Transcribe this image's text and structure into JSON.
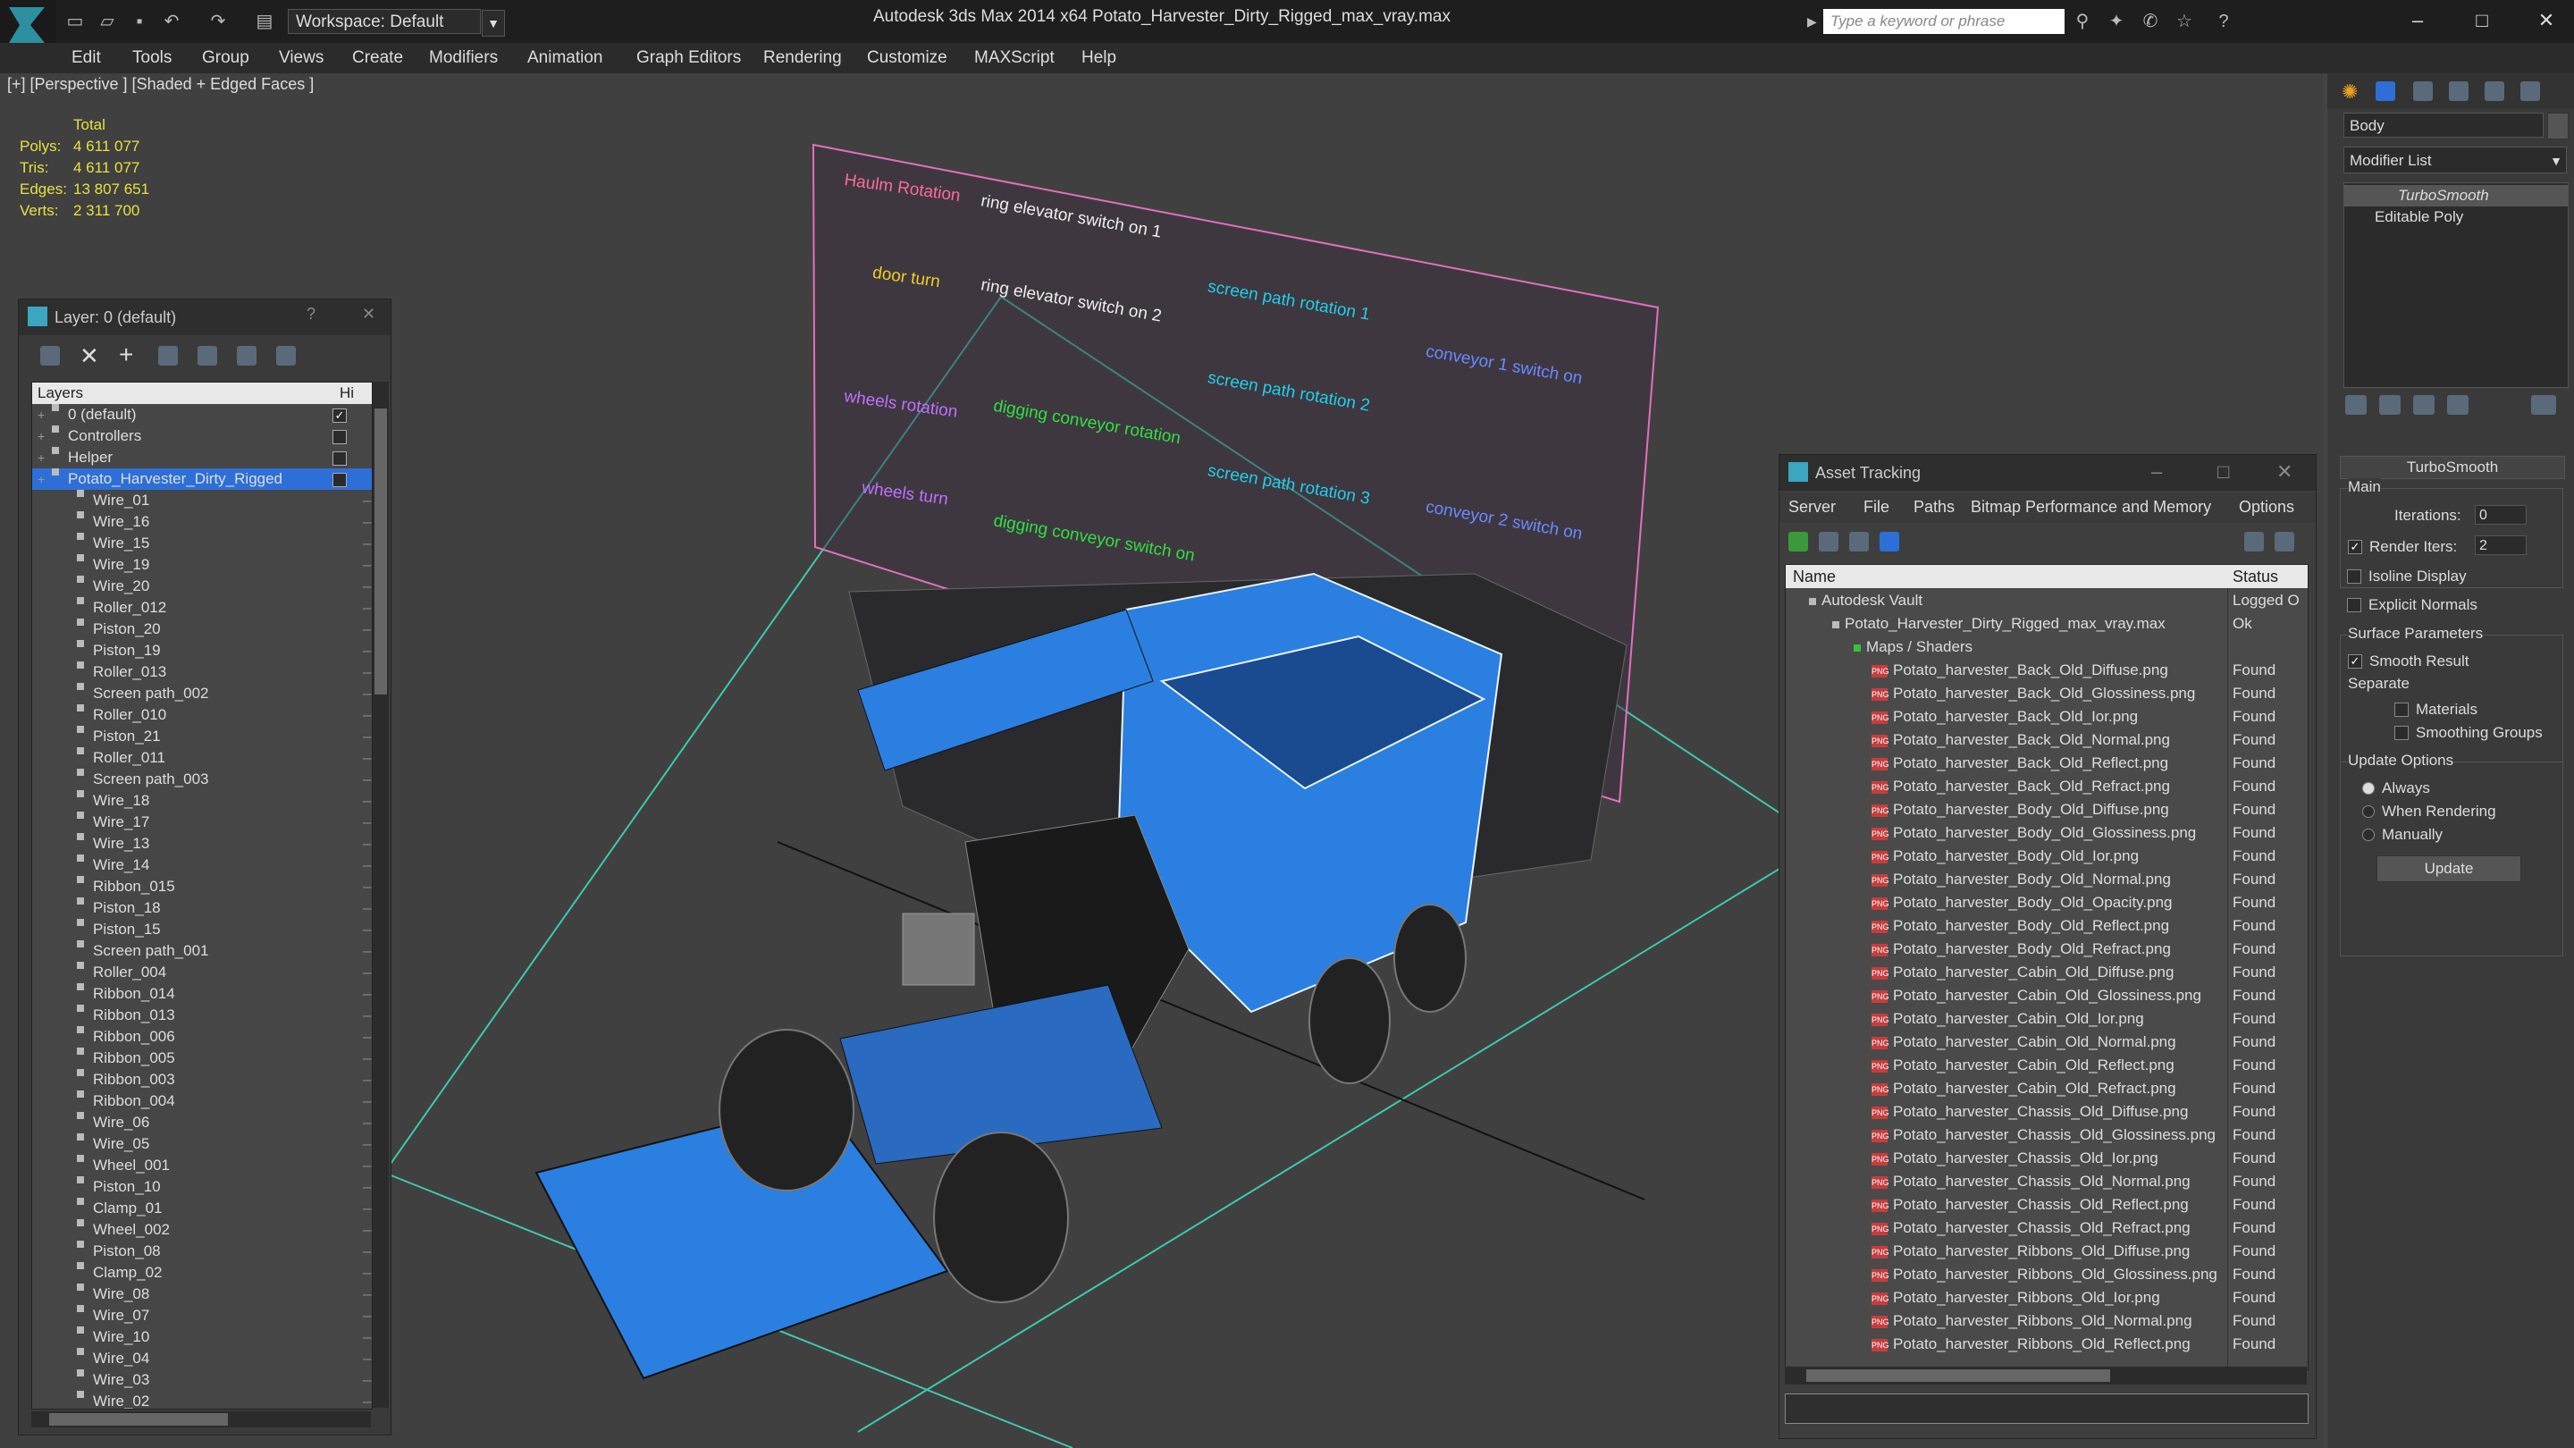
{
  "app": {
    "title": "Autodesk 3ds Max  2014 x64     Potato_Harvester_Dirty_Rigged_max_vray.max",
    "workspace": "Workspace: Default",
    "search_placeholder": "Type a keyword or phrase"
  },
  "menu": [
    "Edit",
    "Tools",
    "Group",
    "Views",
    "Create",
    "Modifiers",
    "Animation",
    "Graph Editors",
    "Rendering",
    "Customize",
    "MAXScript",
    "Help"
  ],
  "viewport": {
    "label": "[+] [Perspective ] [Shaded + Edged Faces ]",
    "stats": {
      "header": "Total",
      "rows": [
        {
          "label": "Polys:",
          "value": "4 611 077"
        },
        {
          "label": "Tris:",
          "value": "4 611 077"
        },
        {
          "label": "Edges:",
          "value": "13 807 651"
        },
        {
          "label": "Verts:",
          "value": "2 311 700"
        }
      ]
    },
    "board_labels": [
      "Haulm Rotation",
      "ring elevator switch on 1",
      "door turn",
      "ring elevator switch on 2",
      "screen path rotation 1",
      "conveyor 1 switch on",
      "wheels rotation",
      "digging conveyor rotation",
      "screen path rotation 2",
      "wheels turn",
      "screen path rotation 3",
      "conveyor 2 switch on",
      "digging conveyor switch on"
    ]
  },
  "layer_panel": {
    "title": "Layer: 0 (default)",
    "help": "?",
    "col_layers": "Layers",
    "col_hide": "Hi",
    "top_layers": [
      {
        "name": "0 (default)",
        "state": "✓"
      },
      {
        "name": "Controllers",
        "state": ""
      },
      {
        "name": "Helper",
        "state": ""
      },
      {
        "name": "Potato_Harvester_Dirty_Rigged",
        "state": ""
      }
    ],
    "objects": [
      "Wire_01",
      "Wire_16",
      "Wire_15",
      "Wire_19",
      "Wire_20",
      "Roller_012",
      "Piston_20",
      "Piston_19",
      "Roller_013",
      "Screen path_002",
      "Roller_010",
      "Piston_21",
      "Roller_011",
      "Screen path_003",
      "Wire_18",
      "Wire_17",
      "Wire_13",
      "Wire_14",
      "Ribbon_015",
      "Piston_18",
      "Piston_15",
      "Screen path_001",
      "Roller_004",
      "Ribbon_014",
      "Ribbon_013",
      "Ribbon_006",
      "Ribbon_005",
      "Ribbon_003",
      "Ribbon_004",
      "Wire_06",
      "Wire_05",
      "Wheel_001",
      "Piston_10",
      "Clamp_01",
      "Wheel_002",
      "Piston_08",
      "Clamp_02",
      "Wire_08",
      "Wire_07",
      "Wire_10",
      "Wire_04",
      "Wire_03",
      "Wire_02"
    ]
  },
  "asset_panel": {
    "title": "Asset Tracking",
    "menu": [
      "Server",
      "File",
      "Paths",
      "Bitmap Performance and Memory",
      "Options"
    ],
    "col_name": "Name",
    "col_status": "Status",
    "vault": {
      "name": "Autodesk Vault",
      "status": "Logged O"
    },
    "file": {
      "name": "Potato_Harvester_Dirty_Rigged_max_vray.max",
      "status": "Ok"
    },
    "maps_label": "Maps / Shaders",
    "maps": [
      {
        "name": "Potato_harvester_Back_Old_Diffuse.png",
        "status": "Found"
      },
      {
        "name": "Potato_harvester_Back_Old_Glossiness.png",
        "status": "Found"
      },
      {
        "name": "Potato_harvester_Back_Old_Ior.png",
        "status": "Found"
      },
      {
        "name": "Potato_harvester_Back_Old_Normal.png",
        "status": "Found"
      },
      {
        "name": "Potato_harvester_Back_Old_Reflect.png",
        "status": "Found"
      },
      {
        "name": "Potato_harvester_Back_Old_Refract.png",
        "status": "Found"
      },
      {
        "name": "Potato_harvester_Body_Old_Diffuse.png",
        "status": "Found"
      },
      {
        "name": "Potato_harvester_Body_Old_Glossiness.png",
        "status": "Found"
      },
      {
        "name": "Potato_harvester_Body_Old_Ior.png",
        "status": "Found"
      },
      {
        "name": "Potato_harvester_Body_Old_Normal.png",
        "status": "Found"
      },
      {
        "name": "Potato_harvester_Body_Old_Opacity.png",
        "status": "Found"
      },
      {
        "name": "Potato_harvester_Body_Old_Reflect.png",
        "status": "Found"
      },
      {
        "name": "Potato_harvester_Body_Old_Refract.png",
        "status": "Found"
      },
      {
        "name": "Potato_harvester_Cabin_Old_Diffuse.png",
        "status": "Found"
      },
      {
        "name": "Potato_harvester_Cabin_Old_Glossiness.png",
        "status": "Found"
      },
      {
        "name": "Potato_harvester_Cabin_Old_Ior.png",
        "status": "Found"
      },
      {
        "name": "Potato_harvester_Cabin_Old_Normal.png",
        "status": "Found"
      },
      {
        "name": "Potato_harvester_Cabin_Old_Reflect.png",
        "status": "Found"
      },
      {
        "name": "Potato_harvester_Cabin_Old_Refract.png",
        "status": "Found"
      },
      {
        "name": "Potato_harvester_Chassis_Old_Diffuse.png",
        "status": "Found"
      },
      {
        "name": "Potato_harvester_Chassis_Old_Glossiness.png",
        "status": "Found"
      },
      {
        "name": "Potato_harvester_Chassis_Old_Ior.png",
        "status": "Found"
      },
      {
        "name": "Potato_harvester_Chassis_Old_Normal.png",
        "status": "Found"
      },
      {
        "name": "Potato_harvester_Chassis_Old_Reflect.png",
        "status": "Found"
      },
      {
        "name": "Potato_harvester_Chassis_Old_Refract.png",
        "status": "Found"
      },
      {
        "name": "Potato_harvester_Ribbons_Old_Diffuse.png",
        "status": "Found"
      },
      {
        "name": "Potato_harvester_Ribbons_Old_Glossiness.png",
        "status": "Found"
      },
      {
        "name": "Potato_harvester_Ribbons_Old_Ior.png",
        "status": "Found"
      },
      {
        "name": "Potato_harvester_Ribbons_Old_Normal.png",
        "status": "Found"
      },
      {
        "name": "Potato_harvester_Ribbons_Old_Reflect.png",
        "status": "Found"
      }
    ]
  },
  "command_panel": {
    "object_name": "Body",
    "modifier_list": "Modifier List",
    "stack": [
      "TurboSmooth",
      "Editable Poly"
    ],
    "rollout_title": "TurboSmooth",
    "main_label": "Main",
    "iterations_label": "Iterations:",
    "iterations_value": "0",
    "render_iters_label": "Render Iters:",
    "render_iters_value": "2",
    "isoline": "Isoline Display",
    "explicit": "Explicit Normals",
    "surface_label": "Surface Parameters",
    "smooth_result": "Smooth Result",
    "separate_label": "Separate",
    "materials": "Materials",
    "smoothing_groups": "Smoothing Groups",
    "update_label": "Update Options",
    "always": "Always",
    "when_rendering": "When Rendering",
    "manually": "Manually",
    "update_button": "Update"
  },
  "colors": {
    "accent": "#2d6fd6",
    "selection": "#2d6fd6",
    "ui_dark": "#2b2b2b",
    "grid": "#3ec8b0"
  }
}
